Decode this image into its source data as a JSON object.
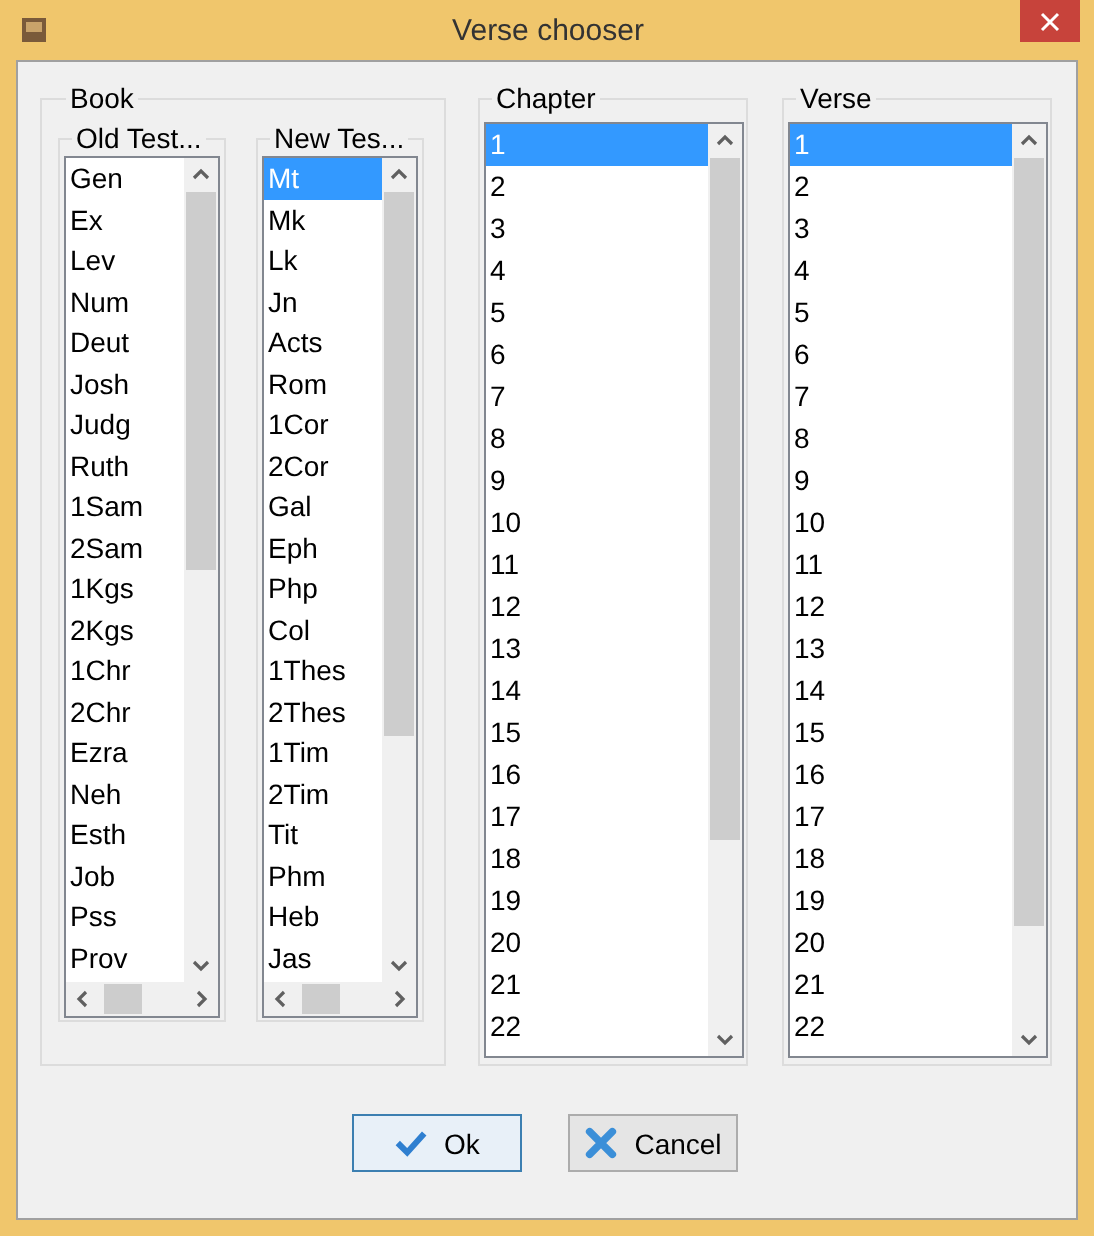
{
  "window": {
    "title": "Verse chooser"
  },
  "book": {
    "label": "Book",
    "old_testament": {
      "label": "Old Test...",
      "items": [
        {
          "text": "Gen",
          "selected": false
        },
        {
          "text": "Ex",
          "selected": false
        },
        {
          "text": "Lev",
          "selected": false
        },
        {
          "text": "Num",
          "selected": false
        },
        {
          "text": "Deut",
          "selected": false
        },
        {
          "text": "Josh",
          "selected": false
        },
        {
          "text": "Judg",
          "selected": false
        },
        {
          "text": "Ruth",
          "selected": false
        },
        {
          "text": "1Sam",
          "selected": false
        },
        {
          "text": "2Sam",
          "selected": false
        },
        {
          "text": "1Kgs",
          "selected": false
        },
        {
          "text": "2Kgs",
          "selected": false
        },
        {
          "text": "1Chr",
          "selected": false
        },
        {
          "text": "2Chr",
          "selected": false
        },
        {
          "text": "Ezra",
          "selected": false
        },
        {
          "text": "Neh",
          "selected": false
        },
        {
          "text": "Esth",
          "selected": false
        },
        {
          "text": "Job",
          "selected": false
        },
        {
          "text": "Pss",
          "selected": false
        },
        {
          "text": "Prov",
          "selected": false
        }
      ]
    },
    "new_testament": {
      "label": "New Tes...",
      "items": [
        {
          "text": "Mt",
          "selected": true
        },
        {
          "text": "Mk",
          "selected": false
        },
        {
          "text": "Lk",
          "selected": false
        },
        {
          "text": "Jn",
          "selected": false
        },
        {
          "text": "Acts",
          "selected": false
        },
        {
          "text": "Rom",
          "selected": false
        },
        {
          "text": "1Cor",
          "selected": false
        },
        {
          "text": "2Cor",
          "selected": false
        },
        {
          "text": "Gal",
          "selected": false
        },
        {
          "text": "Eph",
          "selected": false
        },
        {
          "text": "Php",
          "selected": false
        },
        {
          "text": "Col",
          "selected": false
        },
        {
          "text": "1Thes",
          "selected": false
        },
        {
          "text": "2Thes",
          "selected": false
        },
        {
          "text": "1Tim",
          "selected": false
        },
        {
          "text": "2Tim",
          "selected": false
        },
        {
          "text": "Tit",
          "selected": false
        },
        {
          "text": "Phm",
          "selected": false
        },
        {
          "text": "Heb",
          "selected": false
        },
        {
          "text": "Jas",
          "selected": false
        }
      ]
    }
  },
  "chapter": {
    "label": "Chapter",
    "items": [
      {
        "text": "1",
        "selected": true
      },
      {
        "text": "2",
        "selected": false
      },
      {
        "text": "3",
        "selected": false
      },
      {
        "text": "4",
        "selected": false
      },
      {
        "text": "5",
        "selected": false
      },
      {
        "text": "6",
        "selected": false
      },
      {
        "text": "7",
        "selected": false
      },
      {
        "text": "8",
        "selected": false
      },
      {
        "text": "9",
        "selected": false
      },
      {
        "text": "10",
        "selected": false
      },
      {
        "text": "11",
        "selected": false
      },
      {
        "text": "12",
        "selected": false
      },
      {
        "text": "13",
        "selected": false
      },
      {
        "text": "14",
        "selected": false
      },
      {
        "text": "15",
        "selected": false
      },
      {
        "text": "16",
        "selected": false
      },
      {
        "text": "17",
        "selected": false
      },
      {
        "text": "18",
        "selected": false
      },
      {
        "text": "19",
        "selected": false
      },
      {
        "text": "20",
        "selected": false
      },
      {
        "text": "21",
        "selected": false
      },
      {
        "text": "22",
        "selected": false
      }
    ]
  },
  "verse": {
    "label": "Verse",
    "items": [
      {
        "text": "1",
        "selected": true
      },
      {
        "text": "2",
        "selected": false
      },
      {
        "text": "3",
        "selected": false
      },
      {
        "text": "4",
        "selected": false
      },
      {
        "text": "5",
        "selected": false
      },
      {
        "text": "6",
        "selected": false
      },
      {
        "text": "7",
        "selected": false
      },
      {
        "text": "8",
        "selected": false
      },
      {
        "text": "9",
        "selected": false
      },
      {
        "text": "10",
        "selected": false
      },
      {
        "text": "11",
        "selected": false
      },
      {
        "text": "12",
        "selected": false
      },
      {
        "text": "13",
        "selected": false
      },
      {
        "text": "14",
        "selected": false
      },
      {
        "text": "15",
        "selected": false
      },
      {
        "text": "16",
        "selected": false
      },
      {
        "text": "17",
        "selected": false
      },
      {
        "text": "18",
        "selected": false
      },
      {
        "text": "19",
        "selected": false
      },
      {
        "text": "20",
        "selected": false
      },
      {
        "text": "21",
        "selected": false
      },
      {
        "text": "22",
        "selected": false
      }
    ]
  },
  "buttons": [
    {
      "label": "Ok",
      "kind": "ok"
    },
    {
      "label": "Cancel",
      "kind": "cancel"
    }
  ]
}
